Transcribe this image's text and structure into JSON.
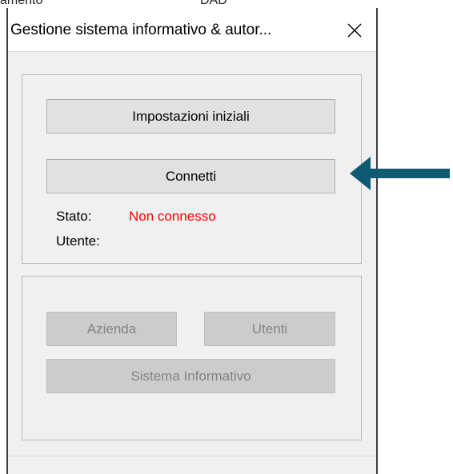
{
  "dialog": {
    "title": "Gestione sistema informativo & autor...",
    "close_glyph": "×"
  },
  "connection": {
    "setup_button": "Impostazioni iniziali",
    "connect_button": "Connetti",
    "status_label": "Stato:",
    "status_value": "Non connesso",
    "user_label": "Utente:"
  },
  "management": {
    "company_button": "Azienda",
    "users_button": "Utenti",
    "info_system_button": "Sistema Informativo"
  },
  "colors": {
    "status_error": "#ff0000",
    "arrow": "#0e5a73",
    "disabled_text": "#838383"
  },
  "annotation": {
    "arrow_icon": "arrow-left-icon"
  }
}
